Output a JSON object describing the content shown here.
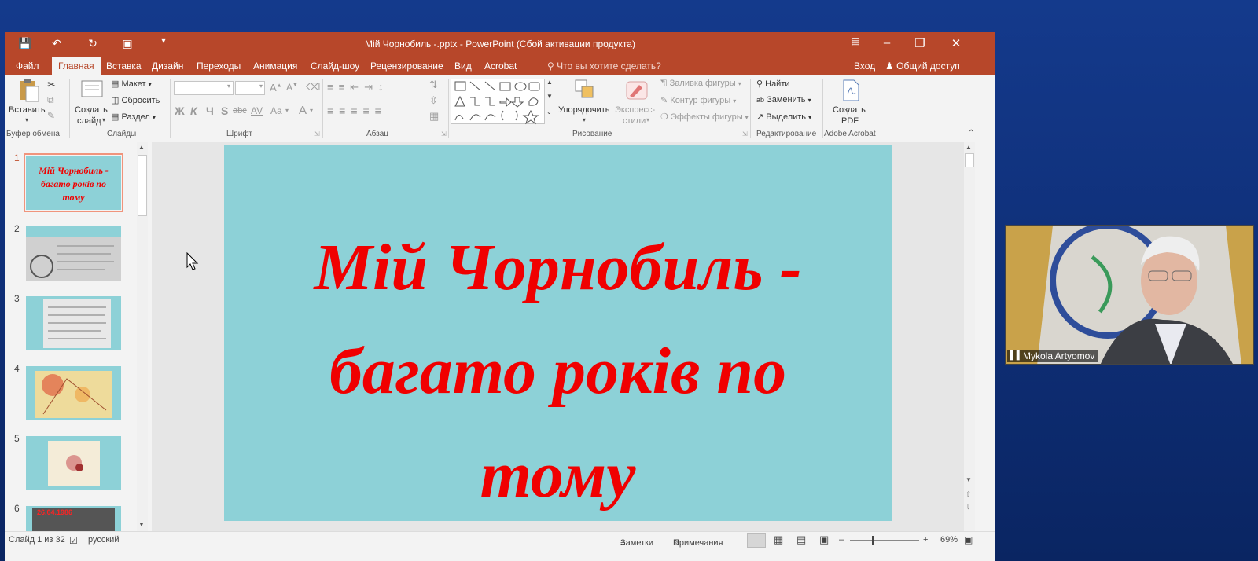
{
  "window": {
    "title": "Мій Чорнобиль -.pptx  -  PowerPoint (Сбой активации продукта)"
  },
  "tabs": [
    "Файл",
    "Главная",
    "Вставка",
    "Дизайн",
    "Переходы",
    "Анимация",
    "Слайд-шоу",
    "Рецензирование",
    "Вид",
    "Acrobat"
  ],
  "tell_me": "Что вы хотите сделать?",
  "signin": "Вход",
  "share": "Общий доступ",
  "ribbon": {
    "paste": "Вставить",
    "new_slide_1": "Создать",
    "new_slide_2": "слайд",
    "layout": "Макет",
    "reset": "Сбросить",
    "section": "Раздел",
    "bold": "Ж",
    "italic": "К",
    "underline": "Ч",
    "strike": "S",
    "shadow": "abc",
    "spacing": "AV",
    "case": "Aa",
    "arrange": "Упорядочить",
    "quick_styles_1": "Экспресс-",
    "quick_styles_2": "стили",
    "shape_fill": "Заливка фигуры",
    "shape_outline": "Контур фигуры",
    "shape_effects": "Эффекты фигуры",
    "find": "Найти",
    "replace": "Заменить",
    "select": "Выделить",
    "create_pdf_1": "Создать",
    "create_pdf_2": "PDF",
    "groups": {
      "clipboard": "Буфер обмена",
      "slides": "Слайды",
      "font": "Шрифт",
      "paragraph": "Абзац",
      "drawing": "Рисование",
      "editing": "Редактирование",
      "acrobat": "Adobe Acrobat"
    }
  },
  "thumbnails": [
    {
      "num": "1",
      "text": "Мій Чорнобиль - багато років по тому"
    },
    {
      "num": "2",
      "text": ""
    },
    {
      "num": "3",
      "text": ""
    },
    {
      "num": "4",
      "text": ""
    },
    {
      "num": "5",
      "text": ""
    },
    {
      "num": "6",
      "text": "26.04.1986"
    }
  ],
  "slide": {
    "line1": "Мій Чорнобиль -",
    "line2": "багато років по",
    "line3": "тому"
  },
  "status": {
    "slide_of": "Слайд 1 из 32",
    "language": "русский",
    "notes": "Заметки",
    "comments": "Примечания",
    "zoom": "69%"
  },
  "participant": {
    "name": "Mykola Artyomov"
  },
  "colors": {
    "ribbon_accent": "#b7472a",
    "slide_bg": "#8dd1d7",
    "slide_text": "#f00000",
    "desktop_bg": "#143a8c"
  }
}
